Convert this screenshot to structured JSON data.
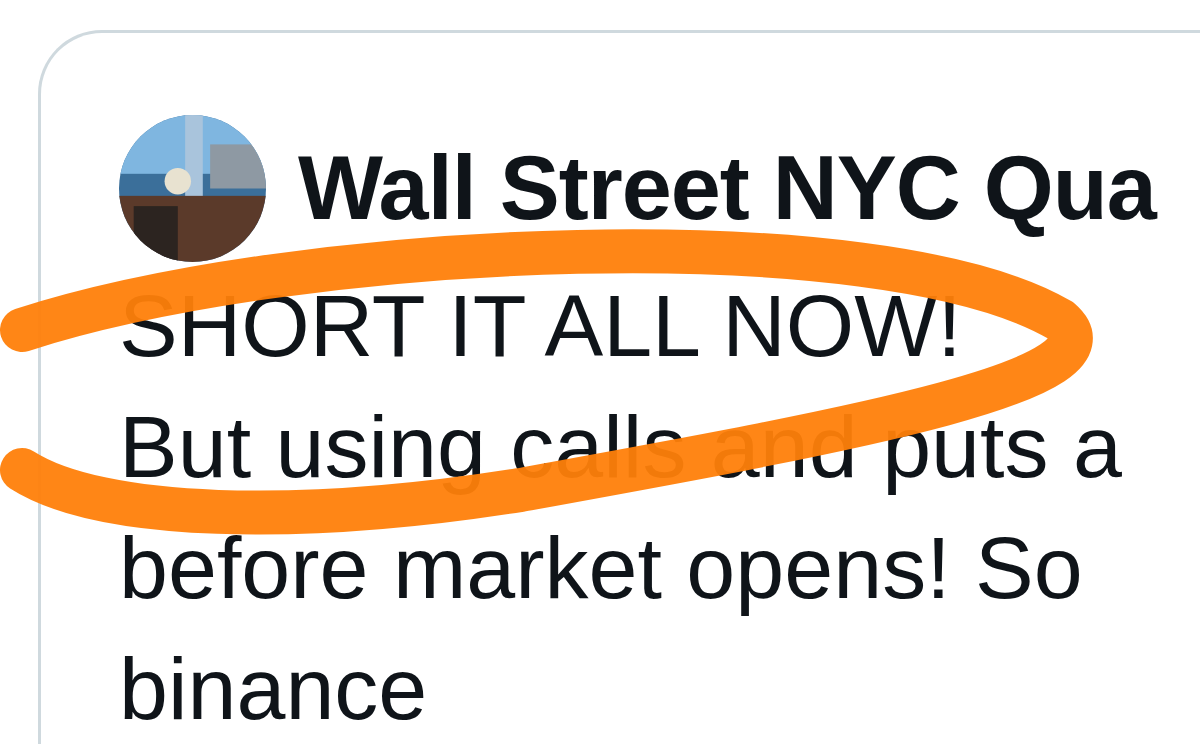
{
  "post": {
    "author": {
      "name": "Wall Street NYC Qua"
    },
    "lines": [
      "SHORT IT ALL NOW!",
      "But using calls and puts a",
      "before market opens! So",
      "binance"
    ]
  },
  "annotation": {
    "kind": "ellipse"
  }
}
